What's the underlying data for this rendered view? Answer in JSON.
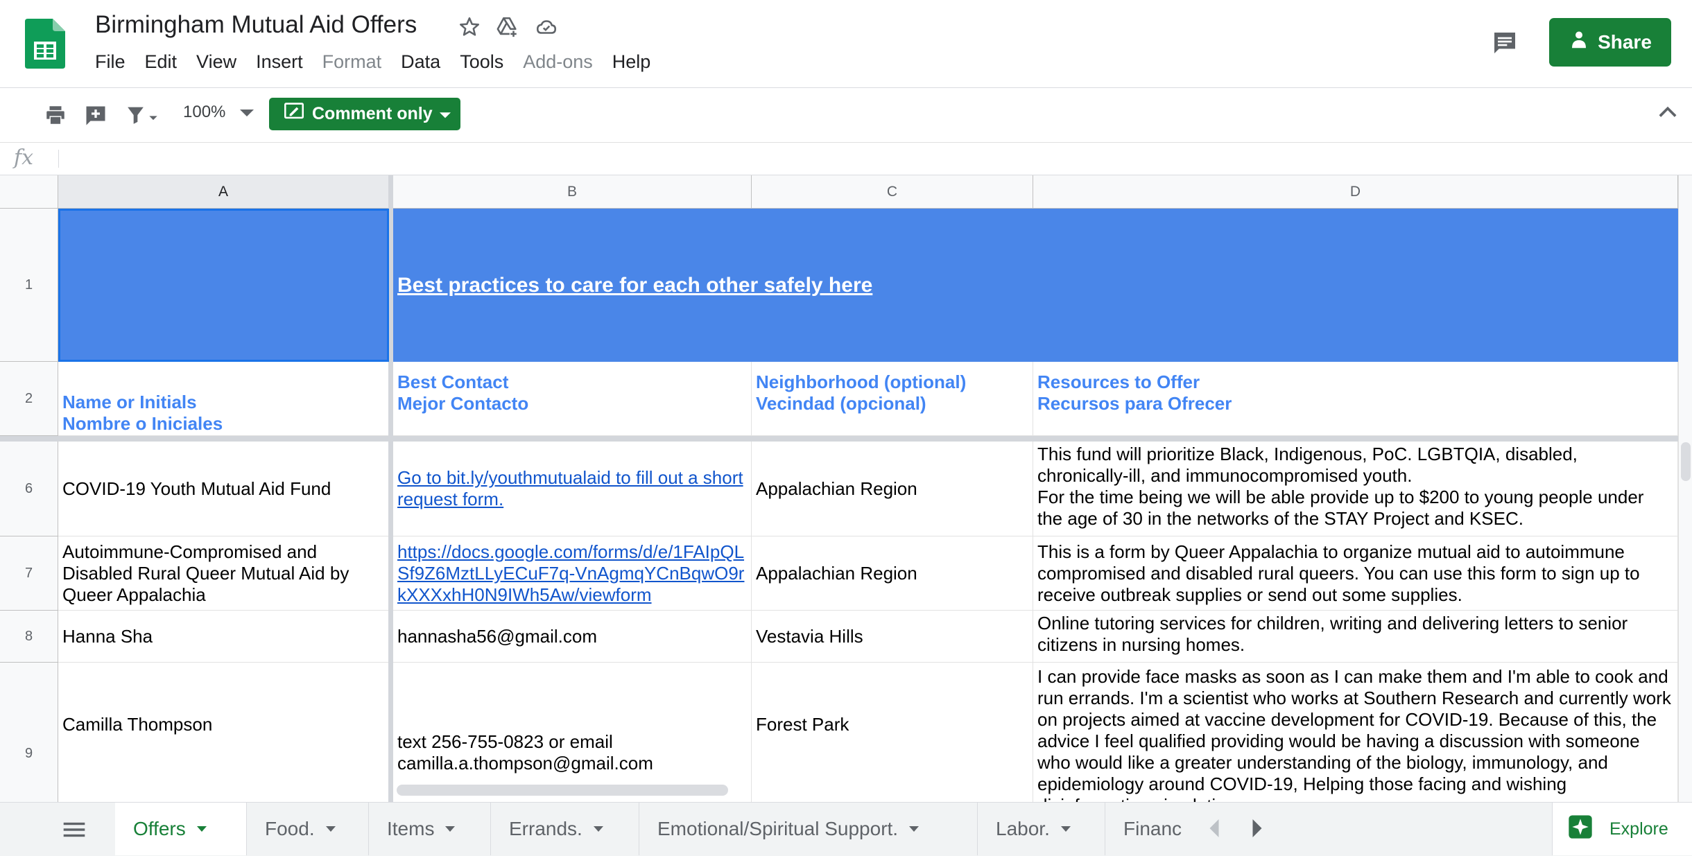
{
  "app": {
    "title": "Birmingham Mutual Aid Offers",
    "menu": [
      {
        "label": "File",
        "enabled": true
      },
      {
        "label": "Edit",
        "enabled": true
      },
      {
        "label": "View",
        "enabled": true
      },
      {
        "label": "Insert",
        "enabled": true
      },
      {
        "label": "Format",
        "enabled": false
      },
      {
        "label": "Data",
        "enabled": true
      },
      {
        "label": "Tools",
        "enabled": true
      },
      {
        "label": "Add-ons",
        "enabled": false
      },
      {
        "label": "Help",
        "enabled": true
      }
    ],
    "share_label": "Share"
  },
  "toolbar": {
    "zoom": "100%",
    "mode_label": "Comment only"
  },
  "formula_bar": {
    "fx": "fx",
    "value": ""
  },
  "columns": [
    "A",
    "B",
    "C",
    "D"
  ],
  "rows": [
    {
      "num": "1"
    },
    {
      "num": "2",
      "cells": [
        "Name or Initials\nNombre o Iniciales",
        "Best Contact\nMejor Contacto",
        "Neighborhood (optional)\nVecindad (opcional)",
        "Resources to Offer\nRecursos para Ofrecer"
      ]
    },
    {
      "num": "6",
      "cells": [
        "COVID-19 Youth Mutual Aid Fund",
        "Go to bit.ly/youthmutualaid to fill out a short request form.",
        "Appalachian Region",
        "This fund will prioritize Black, Indigenous, PoC. LGBTQIA, disabled, chronically-ill, and immunocompromised youth.\nFor the time being we will be able provide up to $200 to young people under the age of 30 in the networks of the STAY Project and KSEC."
      ]
    },
    {
      "num": "7",
      "cells": [
        "Autoimmune-Compromised and Disabled Rural Queer Mutual Aid by Queer Appalachia",
        "https://docs.google.com/forms/d/e/1FAIpQLSf9Z6MztLLyECuF7q-VnAgmqYCnBqwO9rkXXXxhH0N9IWh5Aw/viewform",
        "Appalachian Region",
        "This is a form by Queer Appalachia to organize mutual aid to autoimmune compromised and disabled rural queers. You can use this form to sign up to receive outbreak supplies or send out some supplies."
      ]
    },
    {
      "num": "8",
      "cells": [
        "Hanna Sha",
        "hannasha56@gmail.com",
        "Vestavia Hills",
        "Online tutoring services for children, writing and delivering letters to senior citizens in nursing homes."
      ]
    },
    {
      "num": "9",
      "cells": [
        "Camilla Thompson",
        "text 256-755-0823 or email camilla.a.thompson@gmail.com",
        "Forest Park",
        "I can provide face masks as soon as I can make them and I'm able to cook and run errands. I'm a scientist who works at Southern Research and currently work on projects aimed at vaccine development for COVID-19. Because of this, the advice I feel qualified providing would be having a discussion with someone who would like a greater understanding of the biology, immunology, and epidemiology around COVID-19, Helping those facing and wishing disinformation circulating"
      ]
    }
  ],
  "banner": {
    "link_text": "Best practices to care for each other safely here",
    "fill_color": "#4a86e8"
  },
  "sheet_tabs": [
    {
      "label": "Offers",
      "active": true
    },
    {
      "label": "Food.",
      "active": false
    },
    {
      "label": "Items",
      "active": false
    },
    {
      "label": "Errands.",
      "active": false
    },
    {
      "label": "Emotional/Spiritual Support.",
      "active": false
    },
    {
      "label": "Labor.",
      "active": false
    },
    {
      "label": "Financ",
      "active": false
    }
  ],
  "explore_label": "Explore",
  "colors": {
    "brand_green": "#188038",
    "header_blue": "#4285f4",
    "link_blue": "#1155cc",
    "selection": "#1a73e8"
  }
}
